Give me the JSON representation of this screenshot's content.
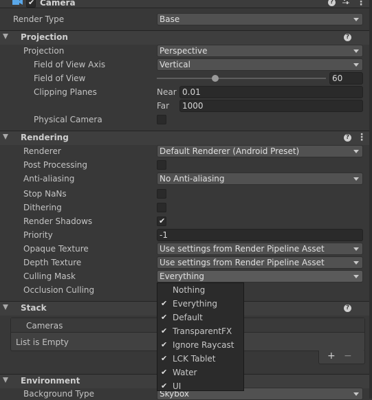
{
  "camera_header": {
    "title": "Camera",
    "enabled": true,
    "preset_icon": "sliders-icon",
    "kebab": "⋮"
  },
  "render_type": {
    "label": "Render Type",
    "value": "Base"
  },
  "projection_section": {
    "title": "Projection",
    "projection": {
      "label": "Projection",
      "value": "Perspective"
    },
    "fov_axis": {
      "label": "Field of View Axis",
      "value": "Vertical"
    },
    "fov": {
      "label": "Field of View",
      "value": "60",
      "slider_fraction": 0.34
    },
    "clipping": {
      "label": "Clipping Planes",
      "near_label": "Near",
      "near_value": "0.01",
      "far_label": "Far",
      "far_value": "1000"
    },
    "physical_camera": {
      "label": "Physical Camera",
      "checked": false
    }
  },
  "rendering_section": {
    "title": "Rendering",
    "renderer": {
      "label": "Renderer",
      "value": "Default Renderer (Android Preset)"
    },
    "post_processing": {
      "label": "Post Processing",
      "checked": false
    },
    "anti_aliasing": {
      "label": "Anti-aliasing",
      "value": "No Anti-aliasing"
    },
    "stop_nans": {
      "label": "Stop NaNs",
      "checked": false
    },
    "dithering": {
      "label": "Dithering",
      "checked": false
    },
    "render_shadows": {
      "label": "Render Shadows",
      "checked": true
    },
    "priority": {
      "label": "Priority",
      "value": "-1"
    },
    "opaque_texture": {
      "label": "Opaque Texture",
      "value": "Use settings from Render Pipeline Asset"
    },
    "depth_texture": {
      "label": "Depth Texture",
      "value": "Use settings from Render Pipeline Asset"
    },
    "culling_mask": {
      "label": "Culling Mask",
      "value": "Everything"
    },
    "occlusion_culling": {
      "label": "Occlusion Culling"
    }
  },
  "stack_section": {
    "title": "Stack",
    "list_header": "Cameras",
    "empty_text": "List is Empty",
    "add": "+",
    "remove": "−"
  },
  "culling_menu": {
    "items": [
      {
        "label": "Nothing",
        "checked": false
      },
      {
        "label": "Everything",
        "checked": true
      },
      {
        "label": "Default",
        "checked": true
      },
      {
        "label": "TransparentFX",
        "checked": true
      },
      {
        "label": "Ignore Raycast",
        "checked": true
      },
      {
        "label": "LCK Tablet",
        "checked": true
      },
      {
        "label": "Water",
        "checked": true
      },
      {
        "label": "UI",
        "checked": true
      }
    ]
  },
  "environment_section": {
    "title": "Environment",
    "background_type": {
      "label": "Background Type",
      "value": "Skybox"
    }
  }
}
